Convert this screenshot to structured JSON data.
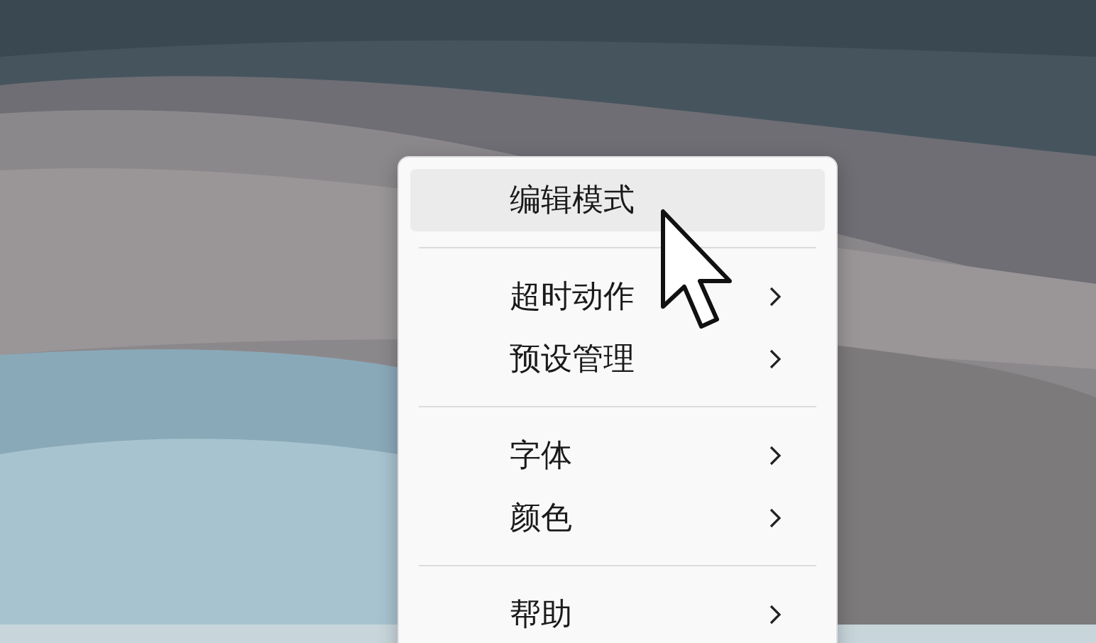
{
  "menu": {
    "items": [
      {
        "kind": "item",
        "label": "编辑模式",
        "selected": true,
        "submenu": false
      },
      {
        "kind": "separator"
      },
      {
        "kind": "item",
        "label": "超时动作",
        "selected": false,
        "submenu": true
      },
      {
        "kind": "item",
        "label": "预设管理",
        "selected": false,
        "submenu": true
      },
      {
        "kind": "separator"
      },
      {
        "kind": "item",
        "label": "字体",
        "selected": false,
        "submenu": true
      },
      {
        "kind": "item",
        "label": "颜色",
        "selected": false,
        "submenu": true
      },
      {
        "kind": "separator"
      },
      {
        "kind": "item",
        "label": "帮助",
        "selected": false,
        "submenu": true
      }
    ]
  }
}
